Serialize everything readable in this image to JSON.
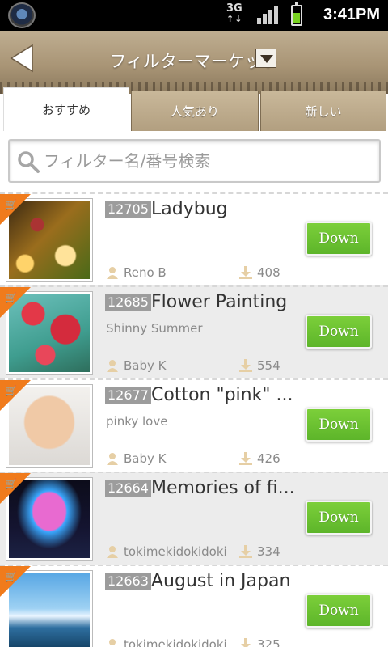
{
  "status_bar": {
    "network": "3G",
    "time": "3:41PM"
  },
  "header": {
    "title": "フィルターマーケット"
  },
  "tabs": [
    {
      "label": "おすすめ",
      "active": true
    },
    {
      "label": "人気あり",
      "active": false
    },
    {
      "label": "新しい",
      "active": false
    }
  ],
  "search": {
    "placeholder": "フィルター名/番号検索",
    "value": ""
  },
  "filters": [
    {
      "number": "12705",
      "name": "Ladybug",
      "subtitle": "",
      "author": "Reno B",
      "downloads": "408",
      "button": "Down"
    },
    {
      "number": "12685",
      "name": "Flower Painting",
      "subtitle": "Shinny Summer",
      "author": "Baby K",
      "downloads": "554",
      "button": "Down"
    },
    {
      "number": "12677",
      "name": "Cotton \"pink\" ...",
      "subtitle": "pinky love",
      "author": "Baby K",
      "downloads": "426",
      "button": "Down"
    },
    {
      "number": "12664",
      "name": "Memories of fi...",
      "subtitle": "",
      "author": "tokimekidokidoki",
      "downloads": "334",
      "button": "Down"
    },
    {
      "number": "12663",
      "name": "August in Japan",
      "subtitle": "",
      "author": "tokimekidokidoki",
      "downloads": "325",
      "button": "Down"
    }
  ],
  "colors": {
    "header_bg": "#a99576",
    "download_button": "#5db52a",
    "cart_ribbon": "#f07b1c",
    "number_badge": "#9c9c9c"
  }
}
